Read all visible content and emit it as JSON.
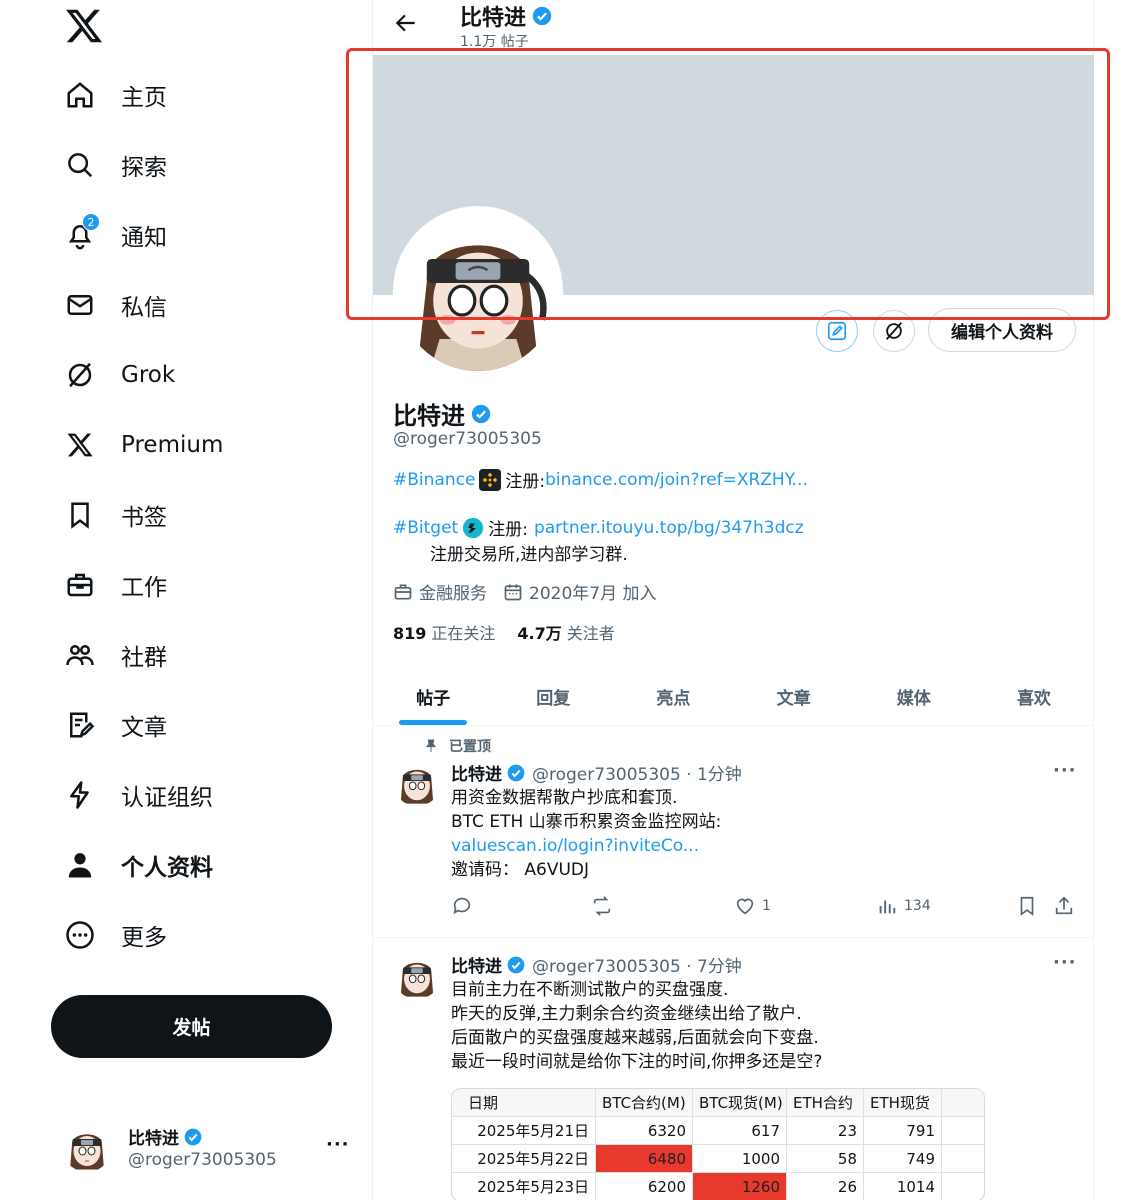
{
  "sidebar": {
    "items": [
      {
        "label": "主页",
        "icon": "home-icon"
      },
      {
        "label": "探索",
        "icon": "search-icon"
      },
      {
        "label": "通知",
        "icon": "bell-icon",
        "badge": "2"
      },
      {
        "label": "私信",
        "icon": "mail-icon"
      },
      {
        "label": "Grok",
        "icon": "grok-icon"
      },
      {
        "label": "Premium",
        "icon": "x-premium-icon"
      },
      {
        "label": "书签",
        "icon": "bookmark-icon"
      },
      {
        "label": "工作",
        "icon": "briefcase-icon"
      },
      {
        "label": "社群",
        "icon": "people-icon"
      },
      {
        "label": "文章",
        "icon": "article-icon"
      },
      {
        "label": "认证组织",
        "icon": "lightning-icon"
      },
      {
        "label": "个人资料",
        "icon": "person-icon"
      },
      {
        "label": "更多",
        "icon": "more-circle-icon"
      }
    ],
    "post_label": "发帖",
    "account": {
      "name": "比特进",
      "handle": "@roger73005305",
      "more": "···"
    }
  },
  "header": {
    "name": "比特进",
    "post_count": "1.1万 帖子"
  },
  "profile": {
    "name": "比特进",
    "handle": "@roger73005305",
    "edit_label": "编辑个人资料",
    "bio": {
      "binance_tag": "#Binance",
      "binance_text": "注册: ",
      "binance_link": "binance.com/join?ref=XRZHY...",
      "bitget_tag": "#Bitget",
      "bitget_text": "注册: ",
      "bitget_link": "partner.itouyu.top/bg/347h3dcz",
      "line3": "注册交易所,进内部学习群."
    },
    "category": "金融服务",
    "joined": "2020年7月 加入",
    "following_count": "819",
    "following_label": "正在关注",
    "followers_count": "4.7万",
    "followers_label": "关注者"
  },
  "tabs": [
    "帖子",
    "回复",
    "亮点",
    "文章",
    "媒体",
    "喜欢"
  ],
  "pinned_label": "已置顶",
  "tweets": [
    {
      "name": "比特进",
      "meta": "@roger73005305 · 1分钟",
      "lines": [
        "用资金数据帮散户抄底和套顶.",
        "BTC ETH 山寨币积累资金监控网站:"
      ],
      "link": "valuescan.io/login?inviteCo...",
      "invite": "邀请码：   A6VUDJ",
      "likes": "1",
      "views": "134"
    },
    {
      "name": "比特进",
      "meta": "@roger73005305 · 7分钟",
      "lines": [
        "目前主力在不断测试散户的买盘强度.",
        "昨天的反弹,主力剩余合约资金继续出给了散户.",
        "后面散户的买盘强度越来越弱,后面就会向下变盘.",
        "最近一段时间就是给你下注的时间,你押多还是空?"
      ]
    }
  ],
  "table": {
    "headers": [
      "日期",
      "BTC合约(M)",
      "BTC现货(M)",
      "ETH合约",
      "ETH现货"
    ],
    "rows": [
      [
        "2025年5月21日",
        "6320",
        "617",
        "23",
        "791"
      ],
      [
        "2025年5月22日",
        "6480",
        "1000",
        "58",
        "749"
      ],
      [
        "2025年5月23日",
        "6200",
        "1260",
        "26",
        "1014"
      ]
    ],
    "highlight_color": "#e8392e"
  },
  "colors": {
    "accent": "#1d9bf0",
    "banner": "#cfd9de",
    "annotation": "#e8392e"
  }
}
